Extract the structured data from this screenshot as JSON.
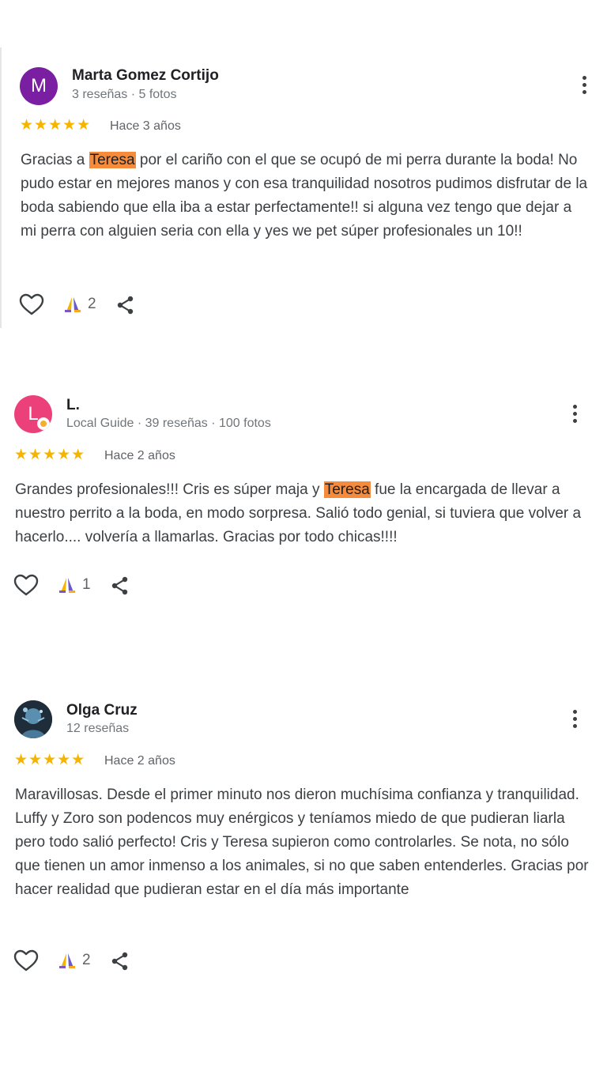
{
  "reviews": [
    {
      "author": "Marta Gomez Cortijo",
      "avatar_letter": "M",
      "avatar_color": "#7b1fa2",
      "meta": "3 reseñas · 5 fotos",
      "stars": "★★★★★",
      "rating": 5,
      "date": "Hace 3 años",
      "text_before": "Gracias a ",
      "highlight": "Teresa",
      "text_after": " por el cariño con el que se ocupó de mi perra durante la boda! No pudo estar en mejores manos y con esa tranquilidad nosotros pudimos disfrutar de la boda sabiendo que ella iba a estar perfectamente!! si alguna vez tengo que dejar a mi perra con alguien seria con ella y yes we pet súper profesionales un 10!!",
      "reactions": "2",
      "icons": [
        "heart-outline-icon",
        "thanks-icon",
        "share-icon",
        "more-vert-icon"
      ]
    },
    {
      "author": "L.",
      "avatar_letter": "L",
      "avatar_color": "#ec407a",
      "meta": "Local Guide · 39 reseñas · 100 fotos",
      "stars": "★★★★★",
      "rating": 5,
      "date": "Hace 2 años",
      "text_before": "Grandes profesionales!!! Cris es súper maja y ",
      "highlight": "Teresa",
      "text_after": " fue la encargada de llevar a nuestro perrito a la boda, en modo sorpresa. Salió todo genial, si tuviera que volver a hacerlo.... volvería a llamarlas. Gracias por todo chicas!!!!",
      "reactions": "1",
      "icons": [
        "heart-outline-icon",
        "thanks-icon",
        "share-icon",
        "more-vert-icon",
        "local-guide-badge-icon"
      ]
    },
    {
      "author": "Olga Cruz",
      "avatar_color": "#2a3b4c",
      "meta": "12 reseñas",
      "stars": "★★★★★",
      "rating": 5,
      "date": "Hace 2 años",
      "text": "Maravillosas. Desde el primer minuto nos dieron muchísima confianza y tranquilidad. Luffy y Zoro son podencos muy enérgicos y teníamos miedo de que pudieran liarla pero todo salió perfecto! Cris y Teresa supieron como controlarles. Se nota, no sólo que tienen un amor inmenso a los animales, si no que saben entenderles. Gracias por hacer realidad que pudieran estar en el día más importante",
      "reactions": "2",
      "icons": [
        "heart-outline-icon",
        "thanks-icon",
        "share-icon",
        "more-vert-icon"
      ]
    }
  ],
  "colors": {
    "star": "#f4b400",
    "highlight": "#f68b3c",
    "text": "#3c4043",
    "secondary": "#70757a"
  }
}
